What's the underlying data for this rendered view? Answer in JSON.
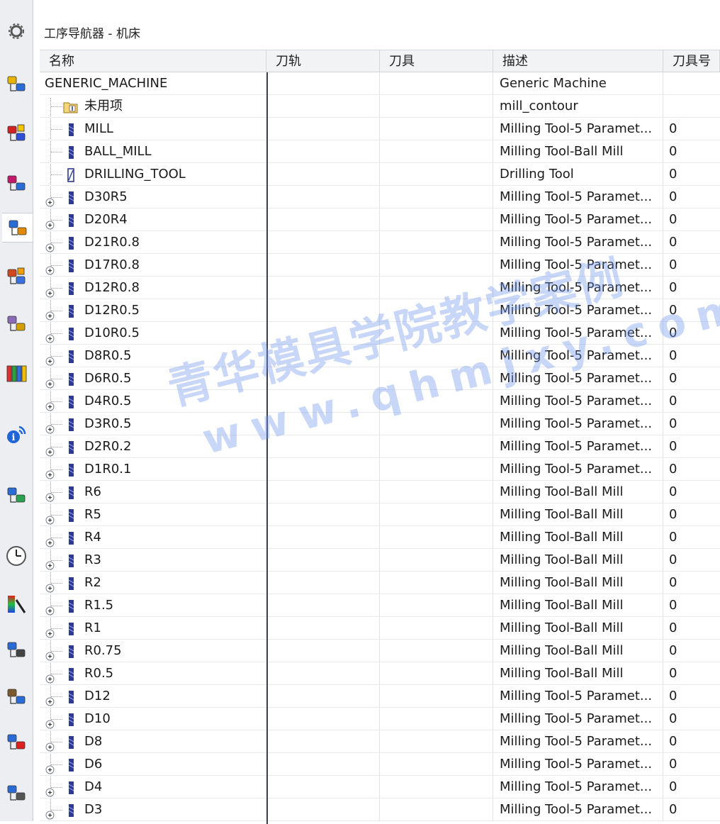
{
  "sidebar": {
    "icons": [
      "gear-icon",
      "part-navigator-icon",
      "assembly-constraint-icon",
      "reuse-library-icon",
      "operation-navigator-icon",
      "history-icon",
      "hd3d-tools-icon",
      "roles-library-icon",
      "info-icon",
      "web-browser-icon",
      "clock-icon",
      "palette-icon",
      "machine-tool-navigator-icon",
      "process-icon",
      "report-icon",
      "list-icon"
    ]
  },
  "navigator": {
    "title": "工序导航器 - 机床",
    "columns": [
      "名称",
      "刀轨",
      "刀具",
      "描述",
      "刀具号"
    ],
    "root": {
      "name": "GENERIC_MACHINE",
      "description": "Generic Machine"
    },
    "rows": [
      {
        "name": "未用项",
        "description": "mill_contour",
        "number": "",
        "icon": "folder-icon",
        "expandable": false
      },
      {
        "name": "MILL",
        "description": "Milling Tool-5 Paramet...",
        "number": "0",
        "icon": "mill-tool-icon",
        "expandable": false
      },
      {
        "name": "BALL_MILL",
        "description": "Milling Tool-Ball Mill",
        "number": "0",
        "icon": "mill-tool-icon",
        "expandable": false
      },
      {
        "name": "DRILLING_TOOL",
        "description": "Drilling Tool",
        "number": "0",
        "icon": "drill-tool-icon",
        "expandable": false
      },
      {
        "name": "D30R5",
        "description": "Milling Tool-5 Paramet...",
        "number": "0",
        "icon": "mill-tool-icon",
        "expandable": true
      },
      {
        "name": "D20R4",
        "description": "Milling Tool-5 Paramet...",
        "number": "0",
        "icon": "mill-tool-icon",
        "expandable": true
      },
      {
        "name": "D21R0.8",
        "description": "Milling Tool-5 Paramet...",
        "number": "0",
        "icon": "mill-tool-icon",
        "expandable": true
      },
      {
        "name": "D17R0.8",
        "description": "Milling Tool-5 Paramet...",
        "number": "0",
        "icon": "mill-tool-icon",
        "expandable": true
      },
      {
        "name": "D12R0.8",
        "description": "Milling Tool-5 Paramet...",
        "number": "0",
        "icon": "mill-tool-icon",
        "expandable": true
      },
      {
        "name": "D12R0.5",
        "description": "Milling Tool-5 Paramet...",
        "number": "0",
        "icon": "mill-tool-icon",
        "expandable": true
      },
      {
        "name": "D10R0.5",
        "description": "Milling Tool-5 Paramet...",
        "number": "0",
        "icon": "mill-tool-icon",
        "expandable": true
      },
      {
        "name": "D8R0.5",
        "description": "Milling Tool-5 Paramet...",
        "number": "0",
        "icon": "mill-tool-icon",
        "expandable": true
      },
      {
        "name": "D6R0.5",
        "description": "Milling Tool-5 Paramet...",
        "number": "0",
        "icon": "mill-tool-icon",
        "expandable": true
      },
      {
        "name": "D4R0.5",
        "description": "Milling Tool-5 Paramet...",
        "number": "0",
        "icon": "mill-tool-icon",
        "expandable": true
      },
      {
        "name": "D3R0.5",
        "description": "Milling Tool-5 Paramet...",
        "number": "0",
        "icon": "mill-tool-icon",
        "expandable": true
      },
      {
        "name": "D2R0.2",
        "description": "Milling Tool-5 Paramet...",
        "number": "0",
        "icon": "mill-tool-icon",
        "expandable": true
      },
      {
        "name": "D1R0.1",
        "description": "Milling Tool-5 Paramet...",
        "number": "0",
        "icon": "mill-tool-icon",
        "expandable": true
      },
      {
        "name": "R6",
        "description": "Milling Tool-Ball Mill",
        "number": "0",
        "icon": "mill-tool-icon",
        "expandable": true
      },
      {
        "name": "R5",
        "description": "Milling Tool-Ball Mill",
        "number": "0",
        "icon": "mill-tool-icon",
        "expandable": true
      },
      {
        "name": "R4",
        "description": "Milling Tool-Ball Mill",
        "number": "0",
        "icon": "mill-tool-icon",
        "expandable": true
      },
      {
        "name": "R3",
        "description": "Milling Tool-Ball Mill",
        "number": "0",
        "icon": "mill-tool-icon",
        "expandable": true
      },
      {
        "name": "R2",
        "description": "Milling Tool-Ball Mill",
        "number": "0",
        "icon": "mill-tool-icon",
        "expandable": true
      },
      {
        "name": "R1.5",
        "description": "Milling Tool-Ball Mill",
        "number": "0",
        "icon": "mill-tool-icon",
        "expandable": true
      },
      {
        "name": "R1",
        "description": "Milling Tool-Ball Mill",
        "number": "0",
        "icon": "mill-tool-icon",
        "expandable": true
      },
      {
        "name": "R0.75",
        "description": "Milling Tool-Ball Mill",
        "number": "0",
        "icon": "mill-tool-icon",
        "expandable": true
      },
      {
        "name": "R0.5",
        "description": "Milling Tool-Ball Mill",
        "number": "0",
        "icon": "mill-tool-icon",
        "expandable": true
      },
      {
        "name": "D12",
        "description": "Milling Tool-5 Paramet...",
        "number": "0",
        "icon": "mill-tool-icon",
        "expandable": true
      },
      {
        "name": "D10",
        "description": "Milling Tool-5 Paramet...",
        "number": "0",
        "icon": "mill-tool-icon",
        "expandable": true
      },
      {
        "name": "D8",
        "description": "Milling Tool-5 Paramet...",
        "number": "0",
        "icon": "mill-tool-icon",
        "expandable": true
      },
      {
        "name": "D6",
        "description": "Milling Tool-5 Paramet...",
        "number": "0",
        "icon": "mill-tool-icon",
        "expandable": true
      },
      {
        "name": "D4",
        "description": "Milling Tool-5 Paramet...",
        "number": "0",
        "icon": "mill-tool-icon",
        "expandable": true
      },
      {
        "name": "D3",
        "description": "Milling Tool-5 Paramet...",
        "number": "0",
        "icon": "mill-tool-icon",
        "expandable": true
      }
    ]
  },
  "watermark": {
    "line1": "青华模具学院教学案例",
    "line2": "www.qhmjxy.com"
  },
  "colors": {
    "tool_icon": "#2c3a8f",
    "divider": "#3a3d4f",
    "watermark": "#6e96eb"
  }
}
